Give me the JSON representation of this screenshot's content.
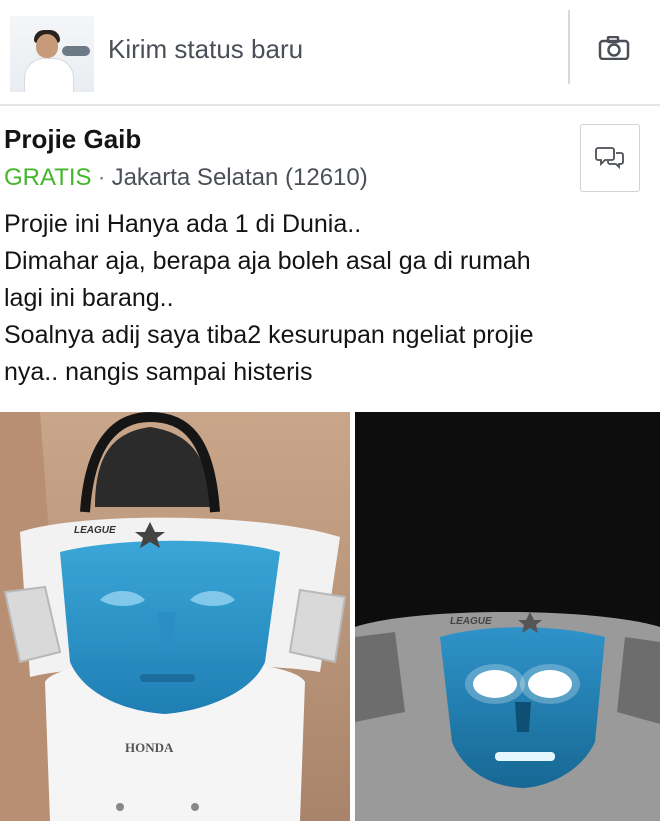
{
  "composer": {
    "placeholder": "Kirim status baru",
    "avatar_icon": "user-avatar",
    "camera_icon": "camera-icon"
  },
  "post": {
    "title": "Projie Gaib",
    "price": "GRATIS",
    "separator": "·",
    "location": "Jakarta Selatan (12610)",
    "message_icon": "chat-bubbles-icon",
    "description_lines": [
      "Projie ini Hanya ada 1 di Dunia..",
      "Dimahar aja, berapa aja boleh asal ga di rumah",
      "lagi ini barang..",
      "Soalnya adij saya tiba2 kesurupan ngeliat projie",
      "nya.. nangis sampai histeris"
    ],
    "photos": {
      "left": {
        "badge": "LEAGUE",
        "brand": "HONDA"
      },
      "right": {
        "badge": "LEAGUE"
      }
    }
  },
  "colors": {
    "price_green": "#42b72a",
    "text_dark": "#141414",
    "text_muted": "#4b4f56",
    "divider": "#d5d8dc",
    "mask_blue": "#2f93c9"
  }
}
